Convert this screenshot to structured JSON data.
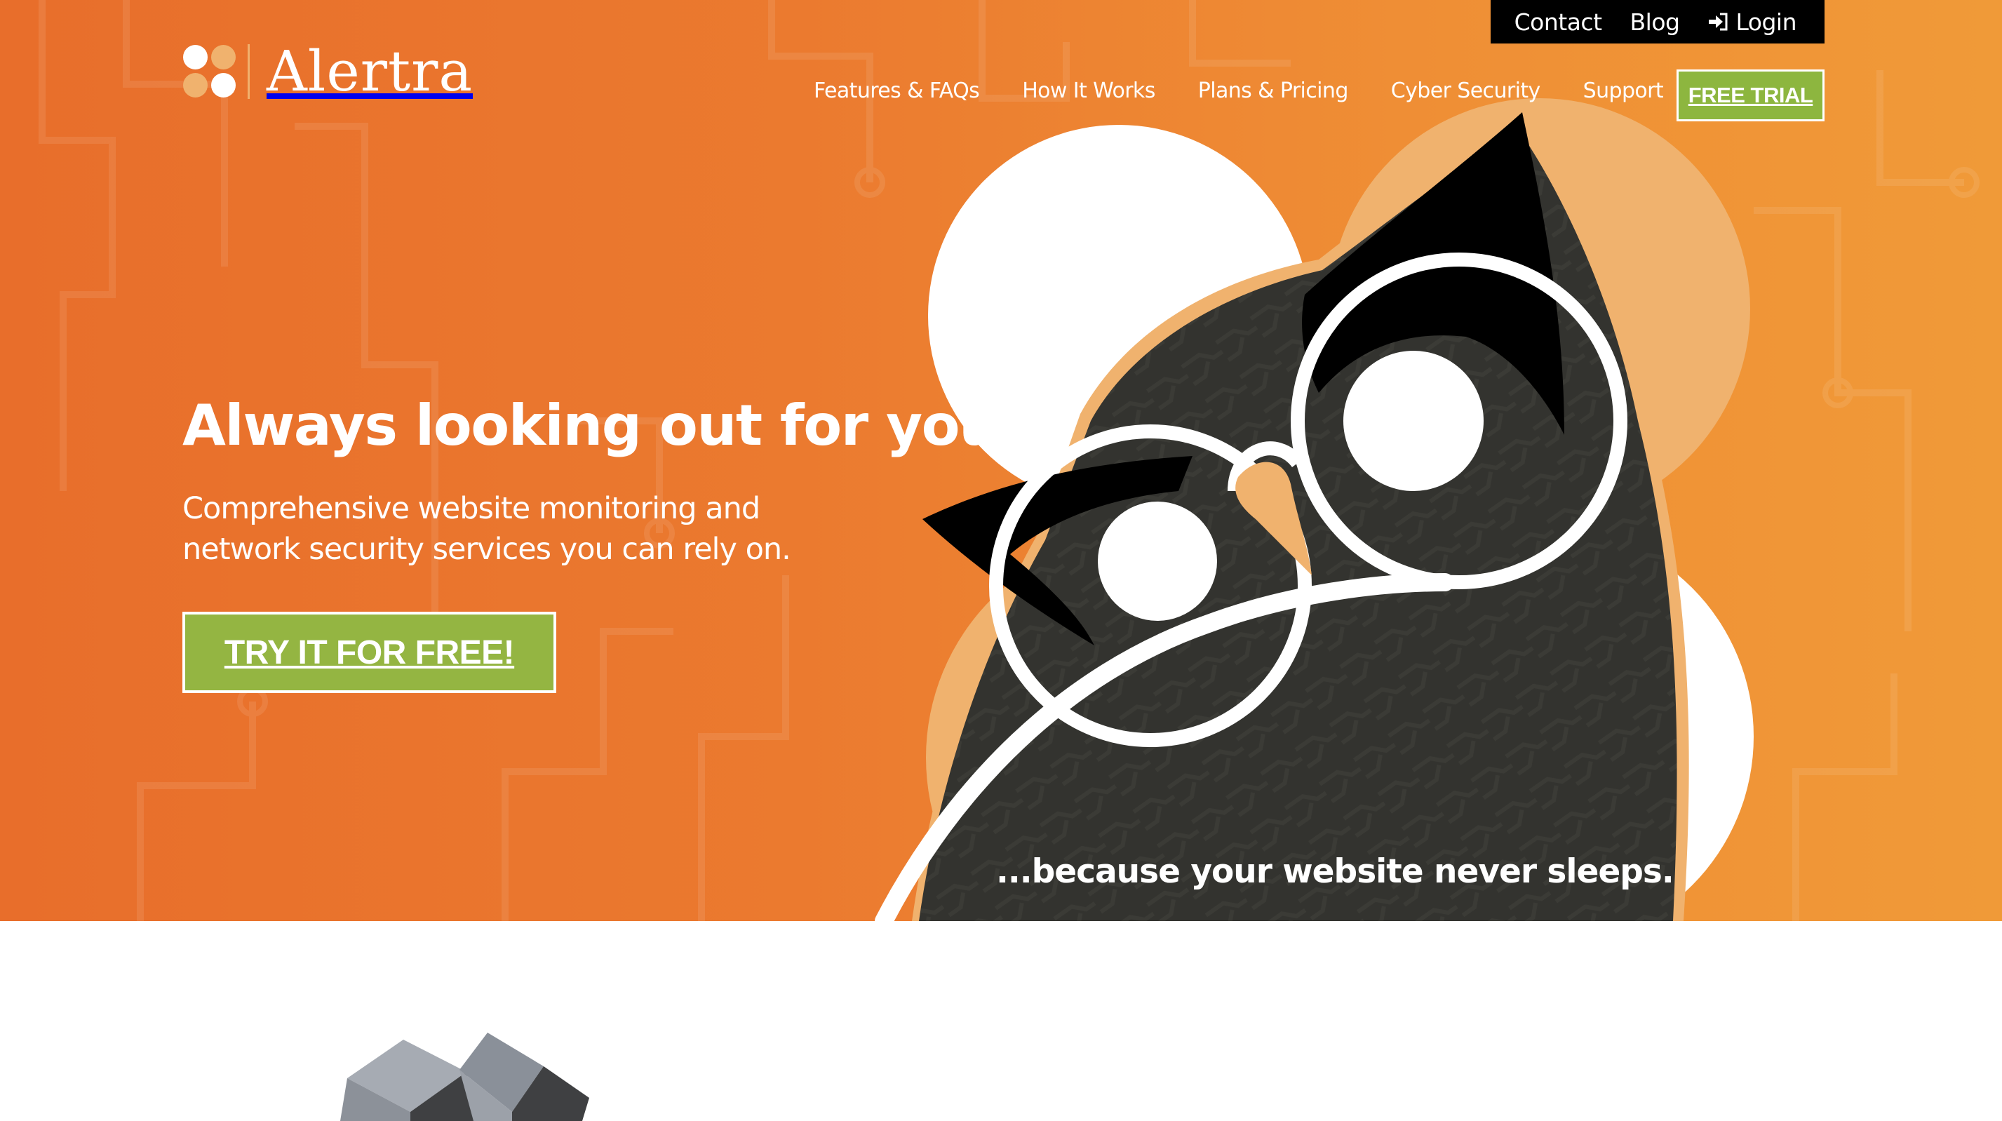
{
  "brand": {
    "name": "Alertra",
    "colors": {
      "hero_orange_left": "#e86e2b",
      "hero_orange_right": "#f09a38",
      "peach": "#f0b26e",
      "green": "#8db63f",
      "owl_body": "#33332f",
      "black": "#000000",
      "white": "#ffffff"
    }
  },
  "utility_nav": {
    "items": [
      {
        "label": "Contact"
      },
      {
        "label": "Blog"
      },
      {
        "label": "Login",
        "icon": "sign-in-icon"
      }
    ]
  },
  "main_nav": {
    "items": [
      {
        "label": "Features & FAQs"
      },
      {
        "label": "How It Works"
      },
      {
        "label": "Plans & Pricing"
      },
      {
        "label": "Cyber Security"
      },
      {
        "label": "Support"
      }
    ],
    "cta_label": "FREE TRIAL"
  },
  "hero": {
    "headline": "Always looking out for you.",
    "subhead": "Comprehensive website monitoring and network security services you can rely on.",
    "cta_label": "TRY IT FOR FREE!",
    "tagline": "...because your website never sleeps.",
    "illustration": "owl-with-glasses"
  },
  "below_fold": {
    "illustration": "gray-cubes"
  }
}
